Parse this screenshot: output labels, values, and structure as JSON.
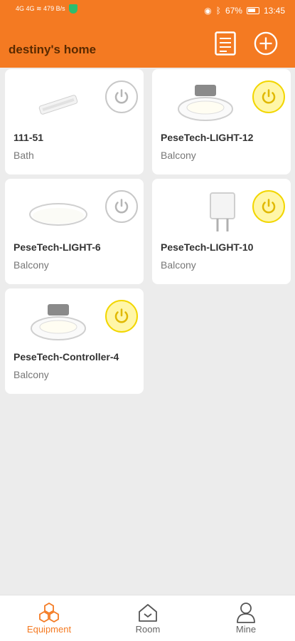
{
  "status": {
    "left_info": "4G 4G ≋ 479 B/s",
    "battery": "67%",
    "time": "13:45"
  },
  "header": {
    "title": "destiny's home"
  },
  "devices": [
    {
      "name": "111-51",
      "room": "Bath",
      "power": "off",
      "icon": "light-bar-icon"
    },
    {
      "name": "PeseTech-LIGHT-12",
      "room": "Balcony",
      "power": "on",
      "icon": "downlight-icon"
    },
    {
      "name": "PeseTech-LIGHT-6",
      "room": "Balcony",
      "power": "off",
      "icon": "panel-light-icon"
    },
    {
      "name": "PeseTech-LIGHT-10",
      "room": "Balcony",
      "power": "on",
      "icon": "plug-icon"
    },
    {
      "name": "PeseTech-Controller-4",
      "room": "Balcony",
      "power": "on",
      "icon": "downlight-icon"
    }
  ],
  "tabs": {
    "equipment": "Equipment",
    "room": "Room",
    "mine": "Mine"
  },
  "colors": {
    "accent": "#f47a22",
    "power_on": "#fff6a8",
    "power_off": "#ffffff"
  }
}
